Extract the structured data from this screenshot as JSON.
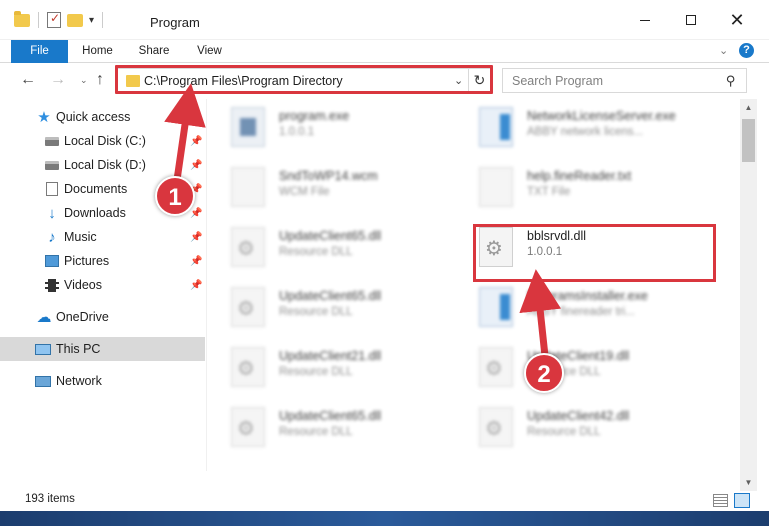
{
  "window": {
    "title": "Program",
    "controls": {
      "minimize": "—",
      "maximize": "☐",
      "close": "✕"
    }
  },
  "ribbon": {
    "tabs": [
      "File",
      "Home",
      "Share",
      "View"
    ],
    "expand_glyph": "⌄",
    "help_glyph": "?"
  },
  "nav": {
    "back": "←",
    "forward": "→",
    "recent": "⌄",
    "up": "↑",
    "address": "C:\\Program Files\\Program Directory",
    "address_dropdown": "⌄",
    "refresh": "↻",
    "search_placeholder": "Search Program",
    "search_glyph": "⚲"
  },
  "sidebar": {
    "items": [
      {
        "label": "Quick access",
        "icon": "star-icon",
        "glyph": "★"
      },
      {
        "label": "Local Disk (C:)",
        "icon": "disk-icon",
        "pinned": true
      },
      {
        "label": "Local Disk (D:)",
        "icon": "disk-icon",
        "pinned": true
      },
      {
        "label": "Documents",
        "icon": "document-icon",
        "pinned": true
      },
      {
        "label": "Downloads",
        "icon": "download-icon",
        "glyph": "↓",
        "pinned": true
      },
      {
        "label": "Music",
        "icon": "music-icon",
        "glyph": "♪",
        "pinned": true
      },
      {
        "label": "Pictures",
        "icon": "pictures-icon",
        "pinned": true
      },
      {
        "label": "Videos",
        "icon": "video-icon",
        "pinned": true
      },
      {
        "label": "OneDrive",
        "icon": "cloud-icon",
        "glyph": "☁"
      },
      {
        "label": "This PC",
        "icon": "computer-icon",
        "selected": true
      },
      {
        "label": "Network",
        "icon": "network-icon"
      }
    ],
    "pin_glyph": "📌"
  },
  "files": [
    {
      "name": "program.exe",
      "sub": "1.0.0.1",
      "icon": "exe"
    },
    {
      "name": "NetworkLicenseServer.exe",
      "sub": "ABBY network licens...",
      "icon": "blue"
    },
    {
      "name": "SndToWP14.wcm",
      "sub": "WCM File",
      "icon": "blank"
    },
    {
      "name": "help.fineReader.txt",
      "sub": "TXT File",
      "icon": "blank"
    },
    {
      "name": "UpdateClient65.dll",
      "sub": "Resource DLL",
      "icon": "gear"
    },
    {
      "name": "bblsrvdl.dll",
      "sub": "1.0.0.1",
      "icon": "gear",
      "highlighted": true
    },
    {
      "name": "UpdateClient65.dll",
      "sub": "Resource DLL",
      "icon": "gear"
    },
    {
      "name": "ProgramsInstaller.exe",
      "sub": "ABBY finereader tri...",
      "icon": "blue"
    },
    {
      "name": "UpdateClient21.dll",
      "sub": "Resource DLL",
      "icon": "gear"
    },
    {
      "name": "UpdateClient19.dll",
      "sub": "Resource DLL",
      "icon": "gear"
    },
    {
      "name": "UpdateClient65.dll",
      "sub": "Resource DLL",
      "icon": "gear"
    },
    {
      "name": "UpdateClient42.dll",
      "sub": "Resource DLL",
      "icon": "gear"
    }
  ],
  "status": {
    "item_count": "193 items"
  },
  "annotations": {
    "step1": "1",
    "step2": "2",
    "color": "#d9363e"
  },
  "colors": {
    "accent": "#1979ca",
    "highlight": "#d9363e",
    "selected_bg": "#d9d9d9"
  }
}
